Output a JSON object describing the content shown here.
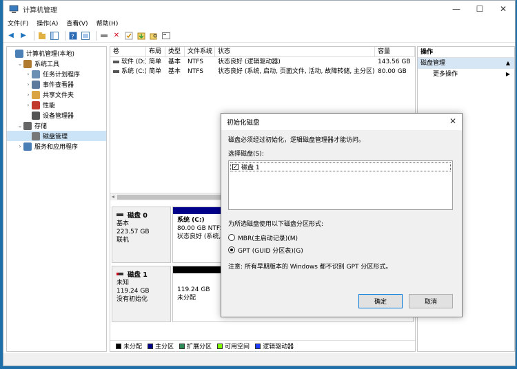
{
  "window": {
    "title": "计算机管理",
    "controls": [
      "—",
      "☐",
      "✕"
    ]
  },
  "menubar": [
    "文件(F)",
    "操作(A)",
    "查看(V)",
    "帮助(H)"
  ],
  "tree": {
    "items": [
      {
        "label": "计算机管理(本地)",
        "indent": 0,
        "arrow": "",
        "icon_color": "#4a7fb5"
      },
      {
        "label": "系统工具",
        "indent": 1,
        "arrow": "⌄",
        "icon_color": "#b07a30"
      },
      {
        "label": "任务计划程序",
        "indent": 2,
        "arrow": "›",
        "icon_color": "#6b8fb3"
      },
      {
        "label": "事件查看器",
        "indent": 2,
        "arrow": "›",
        "icon_color": "#5c7a9c"
      },
      {
        "label": "共享文件夹",
        "indent": 2,
        "arrow": "›",
        "icon_color": "#d9a441"
      },
      {
        "label": "性能",
        "indent": 2,
        "arrow": "›",
        "icon_color": "#c0392b"
      },
      {
        "label": "设备管理器",
        "indent": 2,
        "arrow": "",
        "icon_color": "#555555"
      },
      {
        "label": "存储",
        "indent": 1,
        "arrow": "⌄",
        "icon_color": "#666666"
      },
      {
        "label": "磁盘管理",
        "indent": 2,
        "arrow": "",
        "icon_color": "#777777",
        "selected": true
      },
      {
        "label": "服务和应用程序",
        "indent": 1,
        "arrow": "›",
        "icon_color": "#4a7fb5"
      }
    ]
  },
  "volumes": {
    "headers": [
      "卷",
      "布局",
      "类型",
      "文件系统",
      "状态",
      "容量"
    ],
    "rows": [
      [
        "软件 (D:)",
        "简单",
        "基本",
        "NTFS",
        "状态良好 (逻辑驱动器)",
        "143.56 GB"
      ],
      [
        "系统 (C:)",
        "简单",
        "基本",
        "NTFS",
        "状态良好 (系统, 启动, 页面文件, 活动, 故障转储, 主分区)",
        "80.00 GB"
      ]
    ]
  },
  "disks": [
    {
      "name": "磁盘 0",
      "lines": [
        "基本",
        "223.57 GB",
        "联机"
      ],
      "partition": {
        "bar_color": "#00008b",
        "title": "系统  (C:)",
        "lines": [
          "80.00 GB NTFS",
          "状态良好 (系统, 启"
        ]
      }
    },
    {
      "name": "磁盘 1",
      "lines": [
        "未知",
        "119.24 GB",
        "没有初始化"
      ],
      "partition": {
        "bar_color": "#000000",
        "title": "",
        "lines": [
          "119.24 GB",
          "未分配"
        ]
      }
    }
  ],
  "legend": [
    {
      "label": "未分配",
      "color": "#000000"
    },
    {
      "label": "主分区",
      "color": "#00008b"
    },
    {
      "label": "扩展分区",
      "color": "#2e8b57"
    },
    {
      "label": "可用空间",
      "color": "#7fff00"
    },
    {
      "label": "逻辑驱动器",
      "color": "#1e3cff"
    }
  ],
  "actions": {
    "header": "操作",
    "section": "磁盘管理",
    "more": "更多操作"
  },
  "dialog": {
    "title": "初始化磁盘",
    "intro": "磁盘必须经过初始化，逻辑磁盘管理器才能访问。",
    "select_label": "选择磁盘(S):",
    "disk_entry": "磁盘 1",
    "style_label": "为所选磁盘使用以下磁盘分区形式:",
    "mbr": "MBR(主启动记录)(M)",
    "gpt": "GPT (GUID 分区表)(G)",
    "note": "注意: 所有早期版本的 Windows 都不识别 GPT 分区形式。",
    "ok": "确定",
    "cancel": "取消"
  }
}
